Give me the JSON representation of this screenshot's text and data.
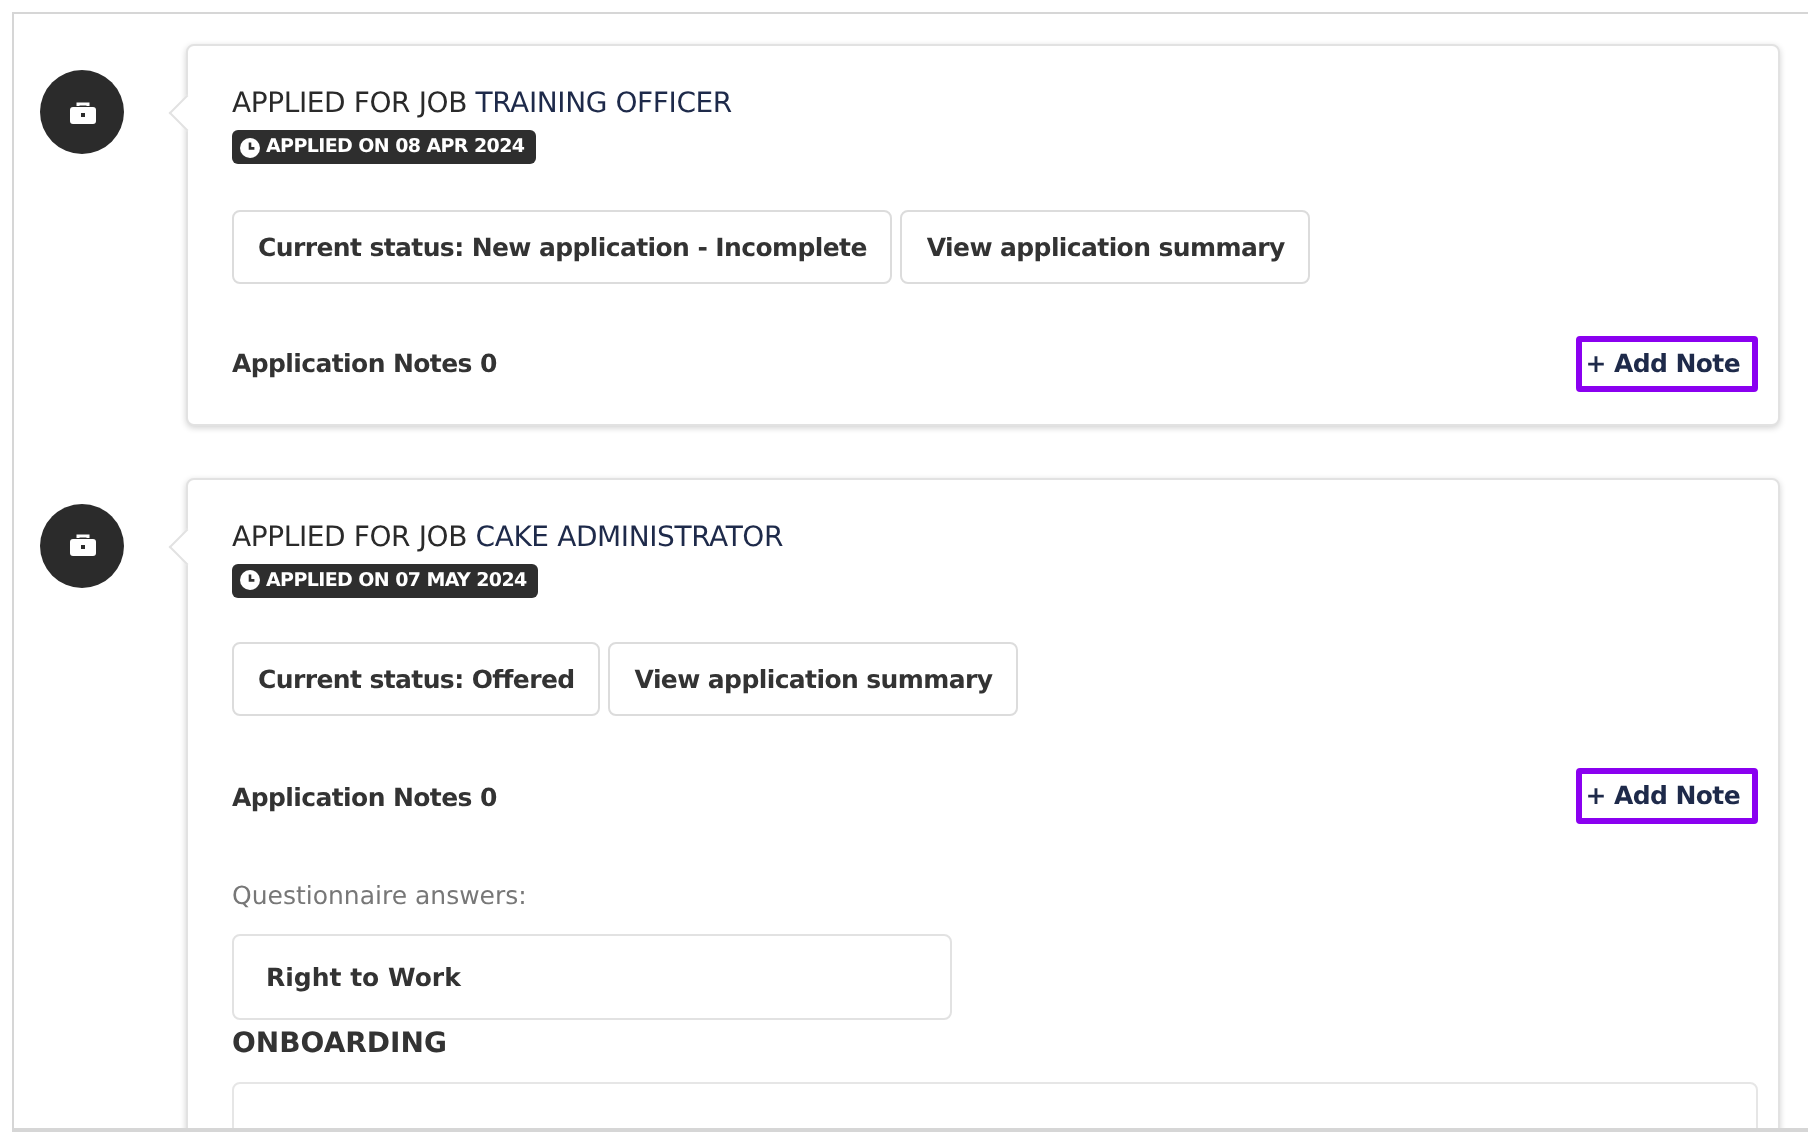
{
  "applications": [
    {
      "prefix": "APPLIED FOR JOB",
      "job_title": "TRAINING OFFICER",
      "applied_on": "APPLIED ON 08 APR 2024",
      "actions": [
        "Current status: New application - Incomplete",
        "View application summary"
      ],
      "notes_label": "Application Notes 0",
      "add_note": {
        "label": "+ Add Note",
        "highlighted": true
      }
    },
    {
      "prefix": "APPLIED FOR JOB",
      "job_title": "CAKE ADMINISTRATOR",
      "applied_on": "APPLIED ON 07 MAY 2024",
      "actions": [
        "Current status: Offered",
        "View application summary"
      ],
      "notes_label": "Application Notes 0",
      "add_note": {
        "label": "+ Add Note",
        "highlighted": true
      },
      "questionnaire_label": "Questionnaire answers:",
      "answers": [
        "Right to Work"
      ],
      "section_heading": "ONBOARDING"
    }
  ]
}
